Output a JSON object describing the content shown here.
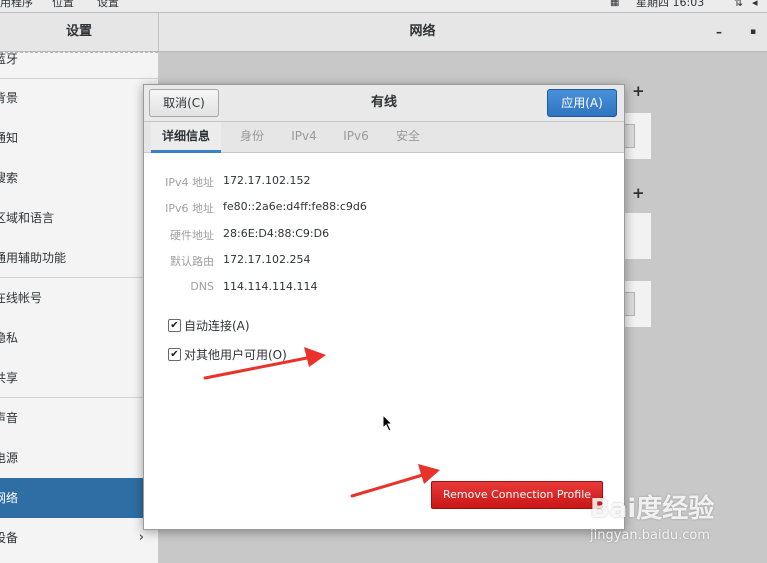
{
  "topbar": {
    "items": [
      "用程序",
      "位置",
      "设置"
    ],
    "clock": "星期四 16:03"
  },
  "header": {
    "sidebar_title": "设置",
    "panel_title": "网络",
    "minimize": "–",
    "close": "▪"
  },
  "sidebar": {
    "items": [
      {
        "label": "蓝牙"
      },
      {
        "label": "背景"
      },
      {
        "label": "通知"
      },
      {
        "label": "搜索"
      },
      {
        "label": "区域和语言"
      },
      {
        "label": "通用辅助功能"
      },
      {
        "label": "在线帐号"
      },
      {
        "label": "隐私"
      },
      {
        "label": "共享"
      },
      {
        "label": "声音"
      },
      {
        "label": "电源"
      },
      {
        "label": "网络"
      },
      {
        "label": "设备"
      }
    ],
    "selected": "网络"
  },
  "dialog": {
    "cancel_label": "取消(C)",
    "title": "有线",
    "apply_label": "应用(A)",
    "tabs": [
      "详细信息",
      "身份",
      "IPv4",
      "IPv6",
      "安全"
    ],
    "active_tab": "详细信息",
    "details": [
      {
        "label": "IPv4 地址",
        "value": "172.17.102.152"
      },
      {
        "label": "IPv6 地址",
        "value": "fe80::2a6e:d4ff:fe88:c9d6"
      },
      {
        "label": "硬件地址",
        "value": "28:6E:D4:88:C9:D6"
      },
      {
        "label": "默认路由",
        "value": "172.17.102.254"
      },
      {
        "label": "DNS",
        "value": "114.114.114.114"
      }
    ],
    "checkboxes": [
      {
        "label": "自动连接(A)",
        "checked": true
      },
      {
        "label": "对其他用户可用(O)",
        "checked": true
      }
    ],
    "remove_label": "Remove Connection Profile"
  },
  "watermark": {
    "brand": "Bai度经验",
    "url": "jingyan.baidu.com"
  },
  "colors": {
    "accent": "#2f6ea5",
    "apply": "#3b82d0",
    "danger": "#d71f1f",
    "annotation": "#e8322a"
  }
}
